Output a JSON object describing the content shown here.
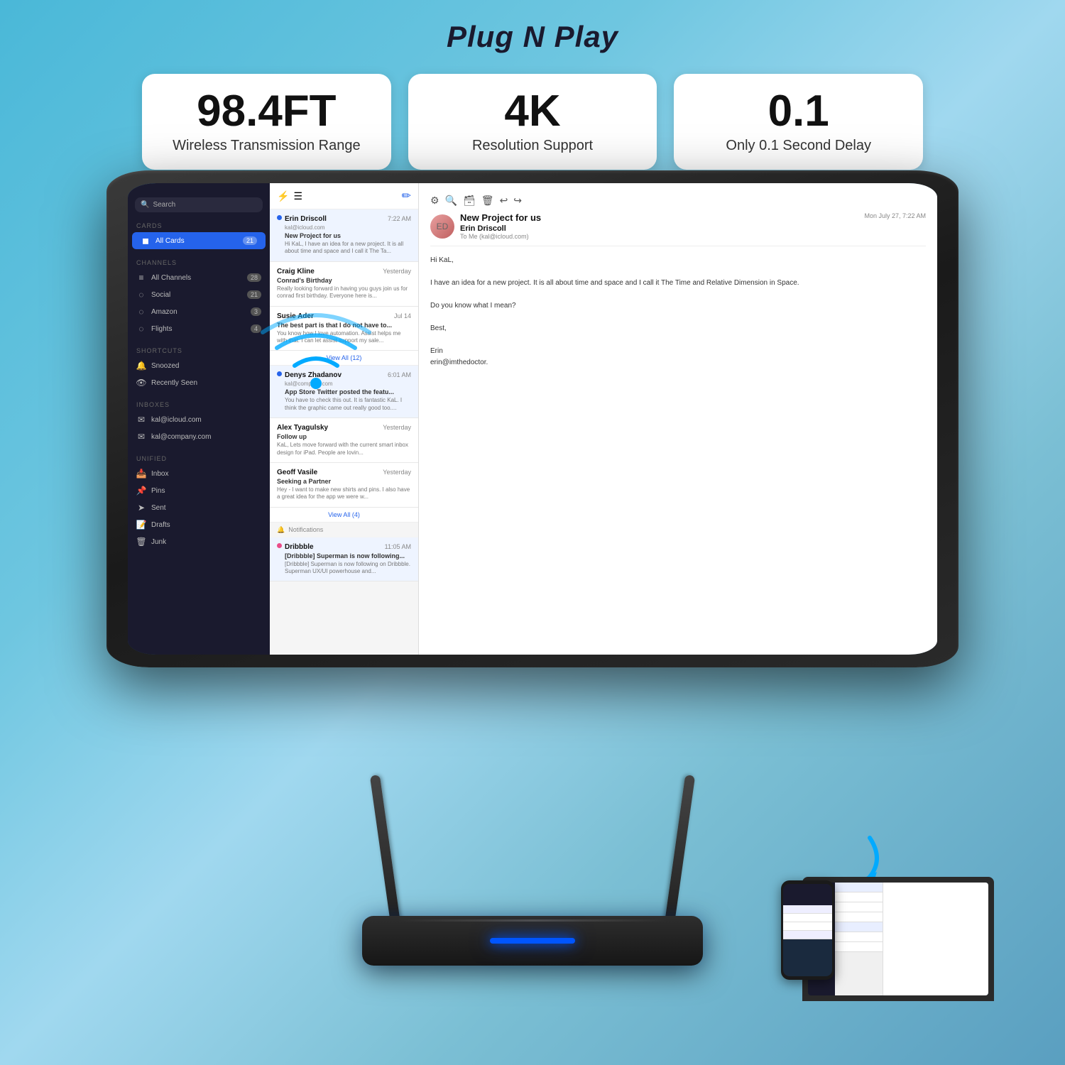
{
  "page": {
    "title": "Plug N Play",
    "background": "linear-gradient to teal-blue"
  },
  "features": [
    {
      "id": "range",
      "big_num": "98.4FT",
      "sub_text": "Wireless Transmission Range"
    },
    {
      "id": "resolution",
      "big_num": "4K",
      "sub_text": "Resolution Support"
    },
    {
      "id": "delay",
      "big_num": "0.1",
      "sub_text": "Only 0.1 Second Delay"
    }
  ],
  "mail_app": {
    "sidebar": {
      "search_placeholder": "Search",
      "cards_section": "CARDS",
      "all_cards_label": "All Cards",
      "all_cards_badge": "21",
      "channels_section": "CHANNELS",
      "channels_items": [
        {
          "label": "All Channels",
          "badge": "28"
        },
        {
          "label": "Social",
          "badge": "21"
        },
        {
          "label": "Amazon",
          "badge": "3"
        },
        {
          "label": "Flights",
          "badge": "4"
        }
      ],
      "shortcuts_section": "SHORTCUTS",
      "shortcuts_items": [
        {
          "label": "Snoozed"
        },
        {
          "label": "Recently Seen"
        }
      ],
      "inboxes_section": "INBOXES",
      "inboxes_items": [
        {
          "label": "kal@icloud.com"
        },
        {
          "label": "kal@company.com"
        }
      ],
      "unified_section": "UNIFIED",
      "unified_items": [
        {
          "label": "Inbox"
        },
        {
          "label": "Pins"
        },
        {
          "label": "Sent"
        },
        {
          "label": "Drafts"
        },
        {
          "label": "Junk"
        }
      ]
    },
    "email_list": {
      "emails": [
        {
          "id": 1,
          "sender": "Erin Driscoll",
          "account": "kal@icloud.com",
          "subject": "New Project for us",
          "preview": "Hi KaL, I have an idea for a new project. It is all about time and space and I call it The Ta...",
          "time": "7:22 AM",
          "unread": true,
          "dot": true
        },
        {
          "id": 2,
          "sender": "Craig Kline",
          "account": "",
          "subject": "Conrad's Birthday",
          "preview": "Really looking forward in having you guys join us for conrad first birthday. Everyone here is...",
          "time": "Yesterday",
          "unread": false,
          "dot": false
        },
        {
          "id": 3,
          "sender": "Susie Ader",
          "account": "",
          "subject": "The best part is that I do not have to...",
          "preview": "You know how I love automation. Assist helps me with that. I can let assist support my sale...",
          "time": "Jul 14",
          "unread": false,
          "dot": false
        }
      ],
      "view_all_12": "View All (12)",
      "emails2": [
        {
          "id": 4,
          "sender": "Denys Zhadanov",
          "account": "kal@company.com",
          "subject": "App Store Twitter posted the featu...",
          "preview": "You have to check this out. It is fantastic KaL. I think the graphic came out really good too....",
          "time": "6:01 AM",
          "unread": true,
          "dot": true
        },
        {
          "id": 5,
          "sender": "Alex Tyagulsky",
          "account": "",
          "subject": "Follow up",
          "preview": "KaL, Lets move forward with the current smart inbox design for iPad. People are lovin...",
          "time": "Yesterday",
          "unread": false,
          "dot": false
        },
        {
          "id": 6,
          "sender": "Geoff Vasile",
          "account": "",
          "subject": "Seeking a Partner",
          "preview": "Hey - I want to make new shirts and pins. I also have a great idea for the app we were w...",
          "time": "Yesterday",
          "unread": false,
          "dot": false
        }
      ],
      "view_all_4": "View All (4)",
      "notifications_label": "Notifications",
      "notification_email": {
        "sender": "Dribbble",
        "subject": "[Dribbble] Superman is now following...",
        "preview": "[Dribbble] Superman is now following on Dribbble. Superman UX/UI powerhouse and...",
        "time": "11:05 AM",
        "unread": true
      }
    },
    "email_detail": {
      "from_name": "Erin Driscoll",
      "subject": "New Project for us",
      "date": "Mon July 27, 7:22 AM",
      "to": "To Me (kal@icloud.com)",
      "body_lines": [
        "Hi KaL,",
        "",
        "I have an idea for a new project. It is all about time and space and I call it The Time and Relative Dimension in Space.",
        "",
        "Do you know what I mean?",
        "",
        "Best,",
        "",
        "Erin",
        "erin@imthedoctor."
      ]
    }
  },
  "device": {
    "label": "wireless HDMI transmitter"
  }
}
